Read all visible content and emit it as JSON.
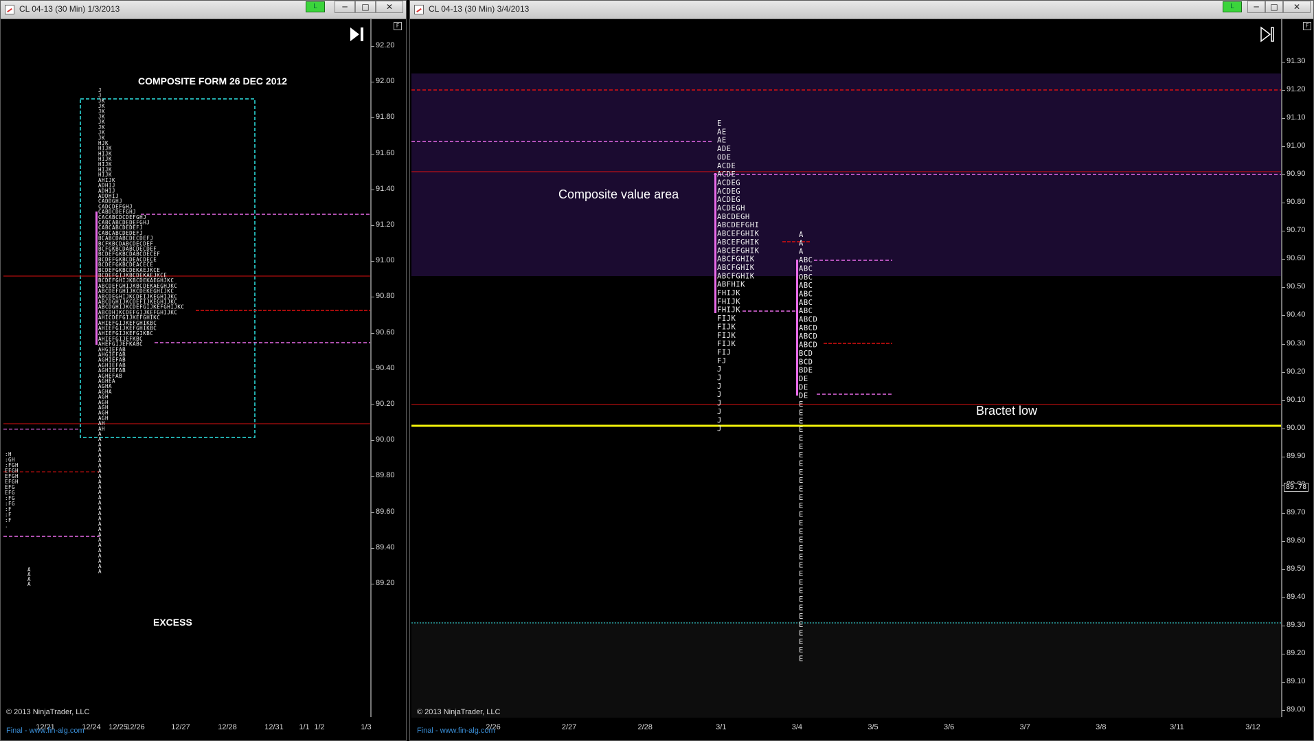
{
  "left": {
    "title": "CL 04-13 (30 Min)  1/3/2013",
    "title_buttons": [
      "─",
      "□",
      "✕"
    ],
    "status_label": "L",
    "f_button": "F",
    "annotations": {
      "composite": "COMPOSITE FORM 26 DEC 2012",
      "excess": "EXCESS"
    },
    "price_labels": [
      "92.20",
      "92.00",
      "91.80",
      "91.60",
      "91.40",
      "91.20",
      "91.00",
      "90.80",
      "90.60",
      "90.40",
      "90.20",
      "90.00",
      "89.80",
      "89.60",
      "89.40",
      "89.20"
    ],
    "date_labels": [
      "12/21",
      "12/24",
      "12/25",
      "12/26",
      "12/27",
      "12/28",
      "12/31",
      "1/1",
      "1/2",
      "1/3"
    ],
    "copyright": "© 2013 NinjaTrader, LLC",
    "footer": "Final - www.fin-alg.com",
    "profile_rows": [
      "J",
      "J",
      "JK",
      "JK",
      "JK",
      "JK",
      "JK",
      "JK",
      "JK",
      "JK",
      "HJK",
      "HIJK",
      "HIJK",
      "HIJK",
      "HIJK",
      "HIJK",
      "HIJK",
      "AHIJK",
      "ADHIJ",
      "ADHIJ",
      "ADDHIJ",
      "CADDGHJ",
      "CADCDEFGHJ",
      "CABDCDEFGHJ",
      "CACABCDCDEFGHJ",
      "CABCABCDEDEFGHJ",
      "CABCABCDEDEFJ",
      "CABCABCDEDEFJ",
      "BCABCDABCDECDEFJ",
      "BCFKBCDABCDECDEF",
      "BCFGKBCDABCDECDEF",
      "BCDEFGKBCDABCDECEF",
      "BCDEFGKBCDEACDECE",
      "BCDEFGKBCDEACECE",
      "BCDEFGKBCDEKAEJKCE",
      "BCDEFGIJKBCDEKAEJKCE",
      "BCDEFGHIJKBCDEKAEGHJKC",
      "ABCDEFGHIJKBCDEKAEGHJKC",
      "ABCDEFGHIJKCDEKEGHIJKC",
      "ABCDEGHIJKCDEIJKEGHIJKC",
      "ABCDGHIJKCDEFIJKEGHIJKC",
      "ABCDGHIJKCDEFGIJKEFGHIJKC",
      "ABCDHIKCDEFGIJKEFGHIJKC",
      "AHICDEFGIJKEFGHIKC",
      "AHIEFGIJKEFGHIKBC",
      "AHIEFGIJKEFGHIKBC",
      "AHIEFGIJKEFGIKBC",
      "AHIEFGIJEFKBC",
      "AHEFGIJEFKABC",
      "AHGIEFAB",
      "AHGIEFAB",
      "AGHIEFAB",
      "AGHIEFAB",
      "AGHIEFAB",
      "AGHEFAB",
      "AGHEA",
      "AGHA",
      "AGHA",
      "AGH",
      "AGH",
      "AGH",
      "AGH",
      "AGH",
      "AH",
      "AH",
      "A",
      "A",
      "A",
      "A",
      "A",
      "A",
      "A",
      "A",
      "A",
      "A",
      "A",
      "A",
      "A",
      "A",
      "A",
      "A",
      "A",
      "A",
      "A",
      "A",
      "A",
      "A",
      "A",
      "A",
      "A",
      "A",
      "A"
    ],
    "side_rows": [
      ":H",
      ":GH",
      ":FGH",
      "EFGH",
      "EFGH",
      "EFGH",
      "EFG",
      "EFG",
      ":FG",
      ":FG",
      ":F",
      ":F",
      ":F",
      "."
    ],
    "bottom_rows": [
      "A",
      "A",
      "A",
      "A"
    ]
  },
  "right": {
    "title": "CL 04-13 (30 Min)  3/4/2013",
    "title_buttons": [
      "─",
      "□",
      "✕"
    ],
    "status_label": "L",
    "f_button": "F",
    "annotations": {
      "value_area": "Composite value area",
      "bractet": "Bractet low"
    },
    "price_labels": [
      "91.30",
      "91.20",
      "91.10",
      "91.00",
      "90.90",
      "90.80",
      "90.70",
      "90.60",
      "90.50",
      "90.40",
      "90.30",
      "90.20",
      "90.10",
      "90.00",
      "89.90",
      "89.80",
      "89.70",
      "89.60",
      "89.50",
      "89.40",
      "89.30",
      "89.20",
      "89.10",
      "89.00"
    ],
    "current_price": "89.78",
    "date_labels": [
      "2/26",
      "2/27",
      "2/28",
      "3/1",
      "3/4",
      "3/5",
      "3/6",
      "3/7",
      "3/8",
      "3/11",
      "3/12"
    ],
    "copyright": "© 2013 NinjaTrader, LLC",
    "footer": "Final - www.fin-alg.com",
    "profile1_rows": [
      "E",
      "AE",
      "AE",
      "ADE",
      "ODE",
      "ACDE",
      "ACDE",
      "ACDEG",
      "ACDEG",
      "ACDEG",
      "ACDEGH",
      "ABCDEGH",
      "ABCDEFGHI",
      "ABCEFGHIK",
      "ABCEFGHIK",
      "ABCEFGHIK",
      "ABCFGHIK",
      "ABCFGHIK",
      "ABCFGHIK",
      "ABFHIK",
      "FHIJK",
      "FHIJK",
      "FHIJK",
      "FIJK",
      "FIJK",
      "FIJK",
      "FIJK",
      "FIJ",
      "FJ",
      "J",
      "J",
      "J",
      "J",
      "J",
      "J",
      "J",
      "J"
    ],
    "profile2_rows": [
      "A",
      "A",
      "A",
      "ABC",
      "ABC",
      "OBC",
      "ABC",
      "ABC",
      "ABC",
      "ABC",
      "ABCD",
      "ABCD",
      "ABCD",
      "ABCD",
      "BCD",
      "BCD",
      "BDE",
      "DE",
      "DE",
      "DE",
      "E",
      "E",
      "E",
      "E",
      "E",
      "E",
      "E",
      "E",
      "E",
      "E",
      "E",
      "E",
      "E",
      "E",
      "E",
      "E",
      "E",
      "E",
      "E",
      "E",
      "E",
      "E",
      "E",
      "E",
      "E",
      "E",
      "E",
      "E",
      "E",
      "E",
      "E"
    ]
  }
}
